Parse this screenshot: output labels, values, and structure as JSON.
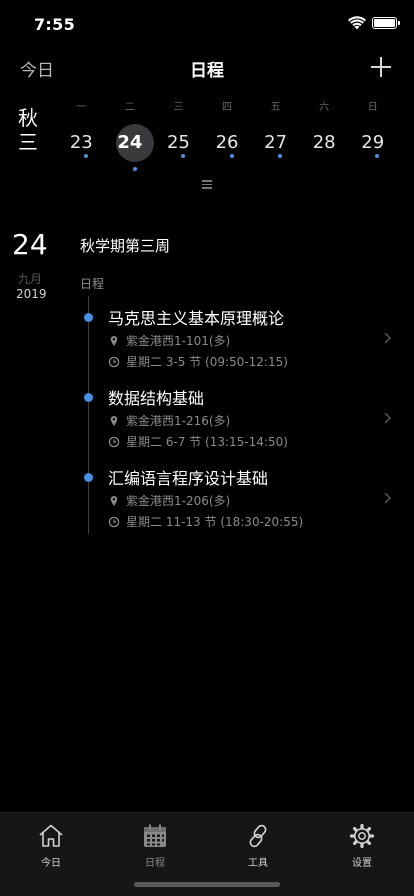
{
  "status_bar": {
    "time": "7:55"
  },
  "nav": {
    "today_label": "今日",
    "title": "日程"
  },
  "week": {
    "term_label_line1": "秋",
    "term_label_line2": "三",
    "weekdays": [
      "一",
      "二",
      "三",
      "四",
      "五",
      "六",
      "日"
    ],
    "dates": [
      {
        "day": "23",
        "has_event": true,
        "selected": false
      },
      {
        "day": "24",
        "has_event": true,
        "selected": true
      },
      {
        "day": "25",
        "has_event": true,
        "selected": false
      },
      {
        "day": "26",
        "has_event": true,
        "selected": false
      },
      {
        "day": "27",
        "has_event": true,
        "selected": false
      },
      {
        "day": "28",
        "has_event": false,
        "selected": false
      },
      {
        "day": "29",
        "has_event": true,
        "selected": false
      }
    ]
  },
  "day": {
    "day_number": "24",
    "month": "九月",
    "year": "2019",
    "week_title": "秋学期第三周",
    "section_label": "日程"
  },
  "events": [
    {
      "name": "马克思主义基本原理概论",
      "location": "紫金港西1-101(多)",
      "time": "星期二 3-5 节 (09:50-12:15)"
    },
    {
      "name": "数据结构基础",
      "location": "紫金港西1-216(多)",
      "time": "星期二 6-7 节 (13:15-14:50)"
    },
    {
      "name": "汇编语言程序设计基础",
      "location": "紫金港西1-206(多)",
      "time": "星期二 11-13 节 (18:30-20:55)"
    }
  ],
  "tab_bar": {
    "tabs": [
      {
        "label": "今日",
        "icon": "home-icon"
      },
      {
        "label": "日程",
        "icon": "calendar-icon"
      },
      {
        "label": "工具",
        "icon": "link-icon"
      },
      {
        "label": "设置",
        "icon": "gear-icon"
      }
    ]
  },
  "colors": {
    "accent": "#4a90e2",
    "background": "#000000",
    "tab_bar": "#161616"
  }
}
